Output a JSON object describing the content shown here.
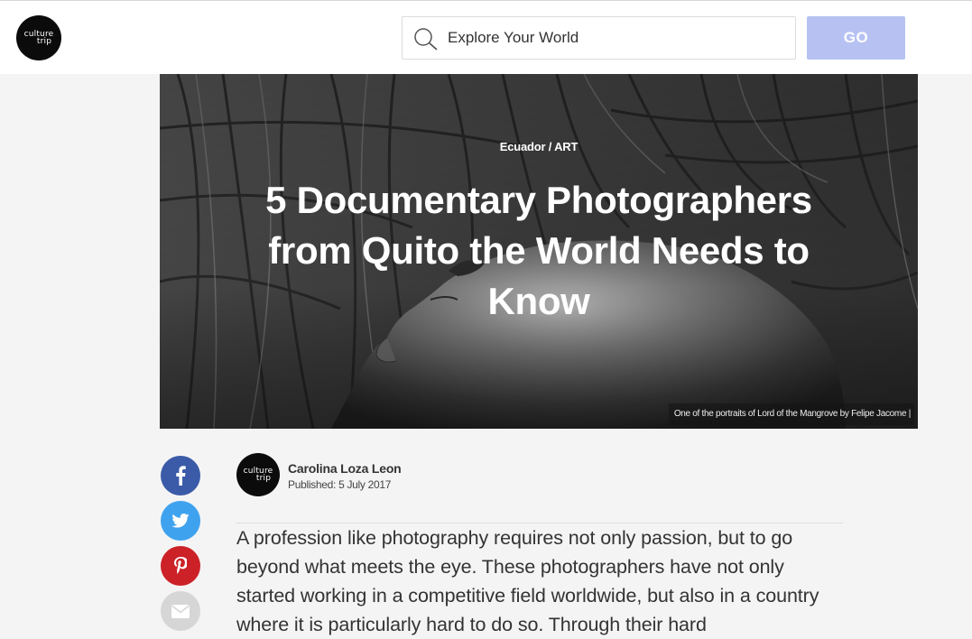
{
  "header": {
    "logo": {
      "line1": "culture",
      "line2": "trip"
    },
    "search": {
      "placeholder": "Explore Your World",
      "icon": "search-icon"
    },
    "go_label": "GO",
    "colors": {
      "go_button": "#b7c2f2"
    }
  },
  "hero": {
    "category": "Ecuador / ART",
    "title": "5 Documentary Photographers from Quito the World Needs to Know",
    "caption": "One of the portraits of Lord of the Mangrove by Felipe Jacome |"
  },
  "share": [
    {
      "network": "facebook",
      "icon": "facebook-icon",
      "color": "#3b5aa8"
    },
    {
      "network": "twitter",
      "icon": "twitter-icon",
      "color": "#3fa2ee"
    },
    {
      "network": "pinterest",
      "icon": "pinterest-icon",
      "color": "#cc2127"
    },
    {
      "network": "email",
      "icon": "envelope-icon",
      "color": "#d6d6d6"
    }
  ],
  "author": {
    "name": "Carolina Loza Leon",
    "published": "Published: 5 July 2017",
    "avatar": {
      "line1": "culture",
      "line2": "trip"
    }
  },
  "article": {
    "intro": "A profession like photography requires not only passion, but to go beyond what meets the eye. These photographers have not only started working in a competitive field worldwide, but also in a country where it is particularly hard to do so. Through their hard"
  }
}
